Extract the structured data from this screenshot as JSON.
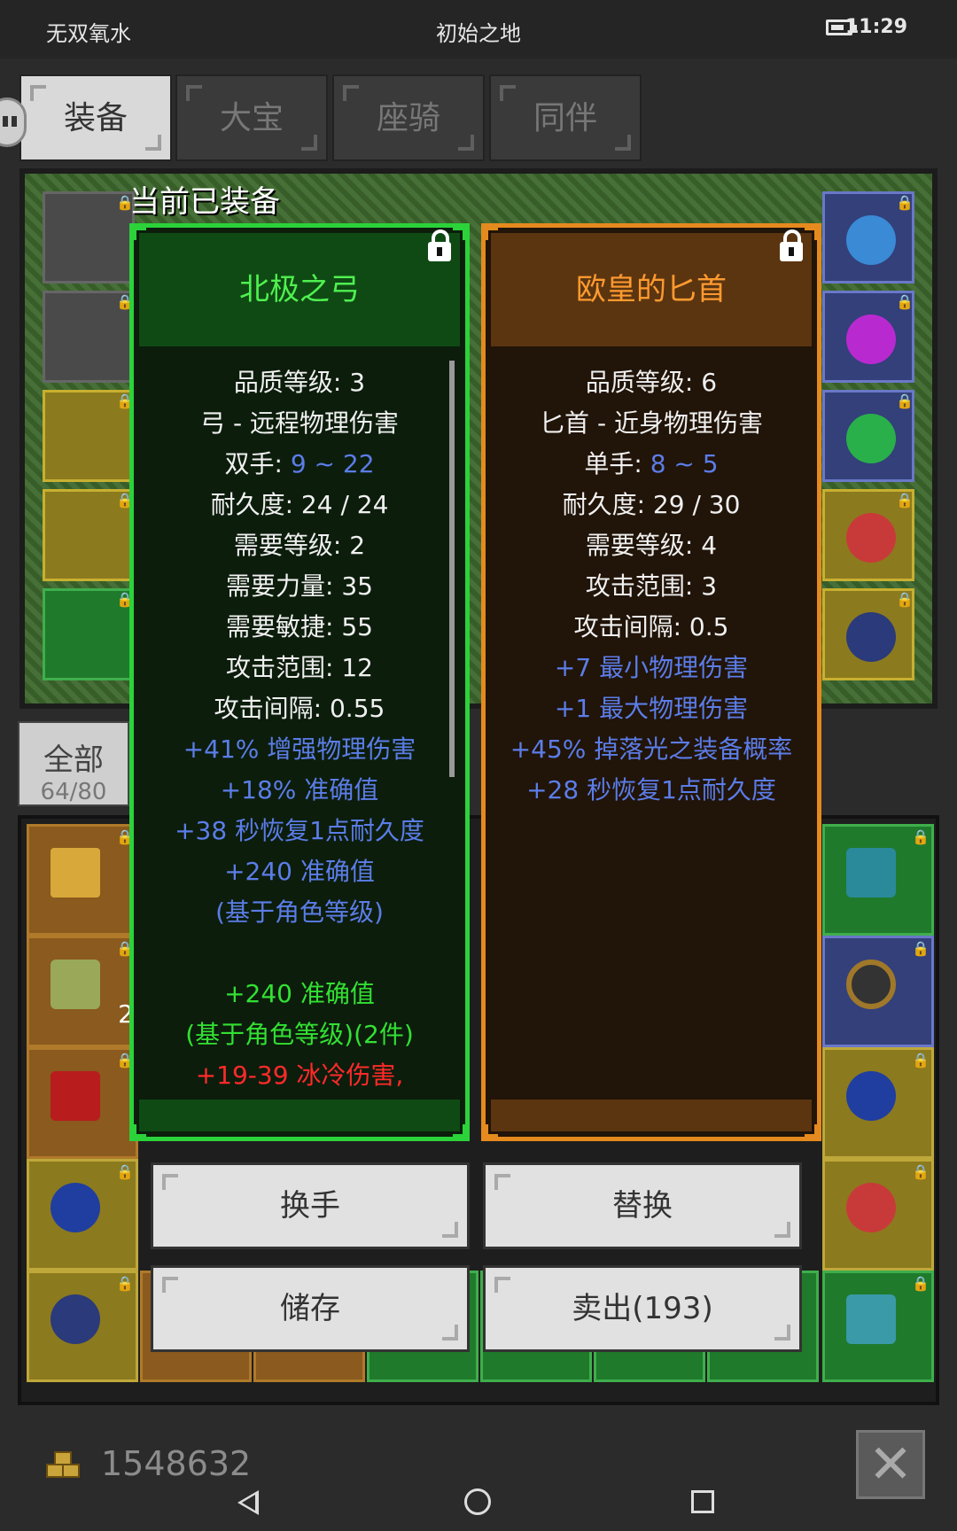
{
  "status_bar": {
    "app_name": "无双氧水",
    "location": "初始之地",
    "time": "11:29"
  },
  "tabs": [
    {
      "label": "装备",
      "active": true
    },
    {
      "label": "大宝",
      "active": false
    },
    {
      "label": "座骑",
      "active": false
    },
    {
      "label": "同伴",
      "active": false
    }
  ],
  "equipped_label": "当前已装备",
  "category": {
    "label": "全部",
    "count": "64/80"
  },
  "inventory_badge": "2",
  "cards": {
    "left": {
      "name": "北极之弓",
      "stats": {
        "quality": "品质等级: 3",
        "type": "弓 - 远程物理伤害",
        "hands_label": "双手: ",
        "hands_value": "9 ~ 22",
        "durability": "耐久度: 24 / 24",
        "req_level": "需要等级: 2",
        "req_str": "需要力量: 35",
        "req_dex": "需要敏捷: 55",
        "range": "攻击范围: 12",
        "interval": "攻击间隔: 0.55"
      },
      "affixes_blue": [
        "+41% 增强物理伤害",
        "+18% 准确值",
        "+38 秒恢复1点耐久度",
        "+240 准确值",
        "(基于角色等级)"
      ],
      "affixes_set": [
        "+240 准确值",
        "(基于角色等级)(2件)"
      ],
      "affix_red": "+19-39 冰冷伤害,"
    },
    "right": {
      "name": "欧皇的匕首",
      "stats": {
        "quality": "品质等级: 6",
        "type": "匕首 - 近身物理伤害",
        "hands_label": "单手: ",
        "hands_value": "8 ~ 5",
        "durability": "耐久度: 29 / 30",
        "req_level": "需要等级: 4",
        "range": "攻击范围: 3",
        "interval": "攻击间隔: 0.5"
      },
      "affixes_blue": [
        "+7 最小物理伤害",
        "+1 最大物理伤害",
        "+45% 掉落光之装备概率",
        "+28 秒恢复1点耐久度"
      ]
    }
  },
  "buttons": {
    "swap_hand": "换手",
    "replace": "替换",
    "store": "储存",
    "sell": "卖出(193)"
  },
  "gold": "1548632",
  "colors": {
    "green_border": "#2bd23a",
    "orange_border": "#e58a1e",
    "blue_text": "#5b7de8",
    "red_text": "#ff2a2a"
  }
}
